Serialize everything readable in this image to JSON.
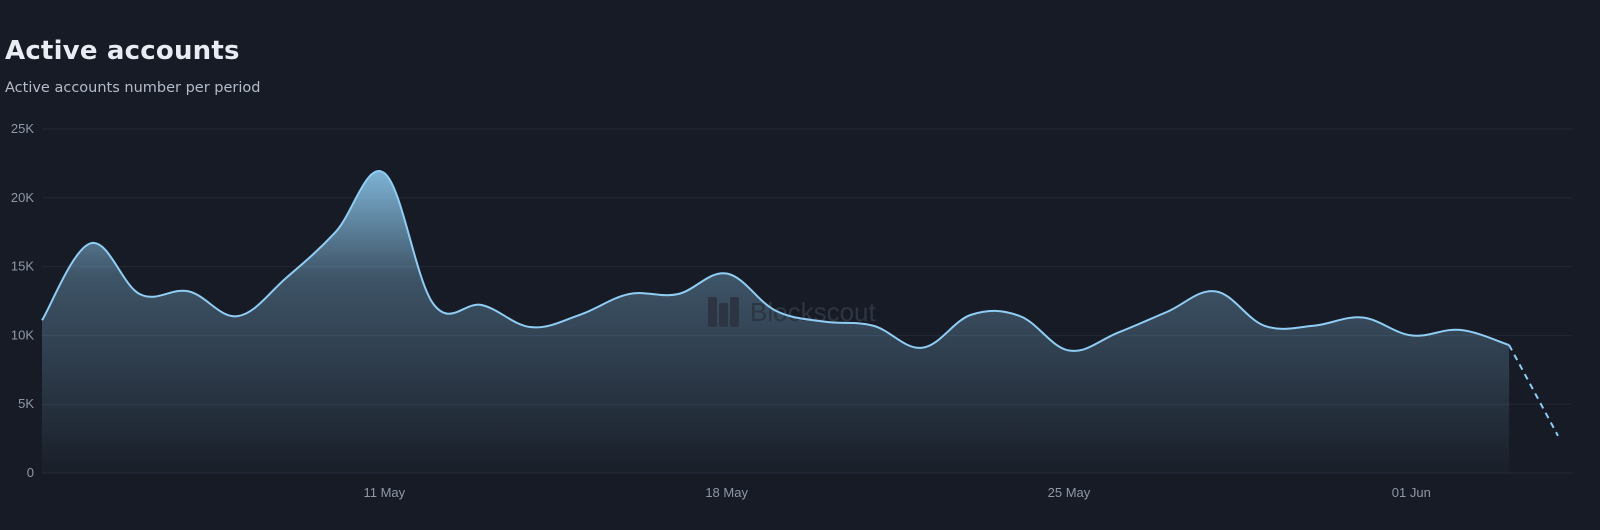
{
  "header": {
    "title": "Active accounts",
    "subtitle": "Active accounts number per period"
  },
  "watermark": "Blockscout",
  "colors": {
    "background": "#171b25",
    "line": "#90cdf4",
    "grid": "#232936",
    "area_top": "#90cdf4"
  },
  "chart_data": {
    "type": "area",
    "title": "Active accounts",
    "subtitle": "Active accounts number per period",
    "xlabel": "",
    "ylabel": "",
    "ylim": [
      0,
      25000
    ],
    "grid": true,
    "y_ticks": [
      0,
      5000,
      10000,
      15000,
      20000,
      25000
    ],
    "y_tick_labels": [
      "0",
      "5K",
      "10K",
      "15K",
      "20K",
      "25K"
    ],
    "x_ticks": [
      "2025-05-11",
      "2025-05-18",
      "2025-05-25",
      "2025-06-01"
    ],
    "x_tick_labels": [
      "11 May",
      "18 May",
      "25 May",
      "01 Jun"
    ],
    "series": [
      {
        "values": [
          {
            "x": "2025-05-04",
            "y": 11100
          },
          {
            "x": "2025-05-05",
            "y": 16700
          },
          {
            "x": "2025-05-06",
            "y": 13000
          },
          {
            "x": "2025-05-07",
            "y": 13200
          },
          {
            "x": "2025-05-08",
            "y": 11400
          },
          {
            "x": "2025-05-09",
            "y": 14200
          },
          {
            "x": "2025-05-10",
            "y": 17500
          },
          {
            "x": "2025-05-11",
            "y": 21800
          },
          {
            "x": "2025-05-12",
            "y": 12300
          },
          {
            "x": "2025-05-13",
            "y": 12200
          },
          {
            "x": "2025-05-14",
            "y": 10600
          },
          {
            "x": "2025-05-15",
            "y": 11500
          },
          {
            "x": "2025-05-16",
            "y": 13000
          },
          {
            "x": "2025-05-17",
            "y": 13000
          },
          {
            "x": "2025-05-18",
            "y": 14500
          },
          {
            "x": "2025-05-19",
            "y": 11800
          },
          {
            "x": "2025-05-20",
            "y": 11000
          },
          {
            "x": "2025-05-21",
            "y": 10700
          },
          {
            "x": "2025-05-22",
            "y": 9100
          },
          {
            "x": "2025-05-23",
            "y": 11500
          },
          {
            "x": "2025-05-24",
            "y": 11400
          },
          {
            "x": "2025-05-25",
            "y": 8900
          },
          {
            "x": "2025-05-26",
            "y": 10200
          },
          {
            "x": "2025-05-27",
            "y": 11700
          },
          {
            "x": "2025-05-28",
            "y": 13200
          },
          {
            "x": "2025-05-29",
            "y": 10700
          },
          {
            "x": "2025-05-30",
            "y": 10700
          },
          {
            "x": "2025-05-31",
            "y": 11300
          },
          {
            "x": "2025-06-01",
            "y": 10000
          },
          {
            "x": "2025-06-02",
            "y": 10400
          },
          {
            "x": "2025-06-03",
            "y": 9300
          },
          {
            "x": "2025-06-04",
            "y": 2700,
            "incomplete": true
          }
        ]
      }
    ]
  }
}
